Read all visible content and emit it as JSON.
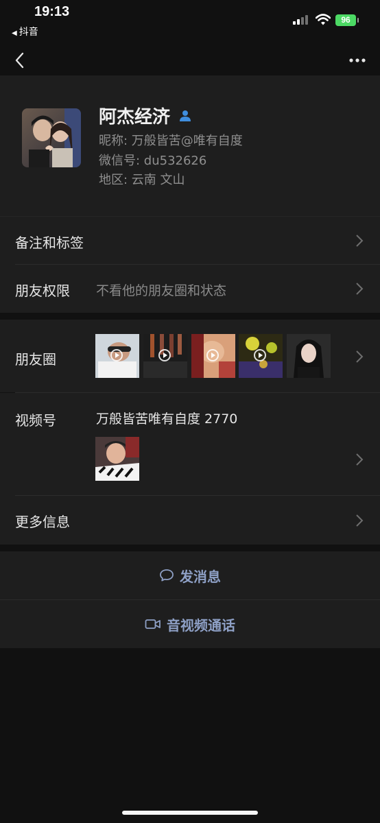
{
  "status": {
    "time": "19:13",
    "back_app": "抖音",
    "battery": "96"
  },
  "profile": {
    "name": "阿杰经济",
    "nickname": "昵称: 万般皆苦@唯有自度",
    "wechat_id": "微信号: du532626",
    "region": "地区: 云南 文山"
  },
  "rows": {
    "remarks_label": "备注和标签",
    "permissions_label": "朋友权限",
    "permissions_value": "不看他的朋友圈和状态",
    "moments_label": "朋友圈",
    "channels_label": "视频号",
    "channels_value": "万般皆苦唯有自度 2770",
    "more_info_label": "更多信息"
  },
  "actions": {
    "send_message": "发消息",
    "video_call": "音视频通话"
  },
  "colors": {
    "background": "#111111",
    "card": "#1e1e1e",
    "action_text": "#8ea0c6",
    "battery": "#4cd964"
  }
}
